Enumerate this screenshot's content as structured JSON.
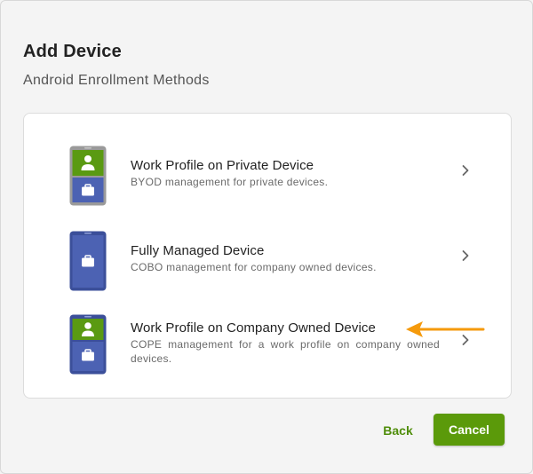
{
  "dialog": {
    "title": "Add Device",
    "subtitle": "Android Enrollment Methods"
  },
  "options": [
    {
      "title": "Work Profile on Private Device",
      "description": "BYOD management for private devices.",
      "icon": "phone-work-profile-private-icon"
    },
    {
      "title": "Fully Managed Device",
      "description": "COBO management for company owned devices.",
      "icon": "phone-fully-managed-icon"
    },
    {
      "title": "Work Profile on Company Owned Device",
      "description": "COPE management for a work profile on company owned devices.",
      "icon": "phone-work-profile-company-icon"
    }
  ],
  "annotation": {
    "pointer": "arrow-left-icon",
    "color": "#f59a0c"
  },
  "footer": {
    "back_label": "Back",
    "cancel_label": "Cancel"
  },
  "colors": {
    "primary_green": "#5b9a0a",
    "profile_green": "#5a9a12",
    "device_blue": "#4c62b3",
    "device_gray_frame": "#9a9a9a"
  }
}
